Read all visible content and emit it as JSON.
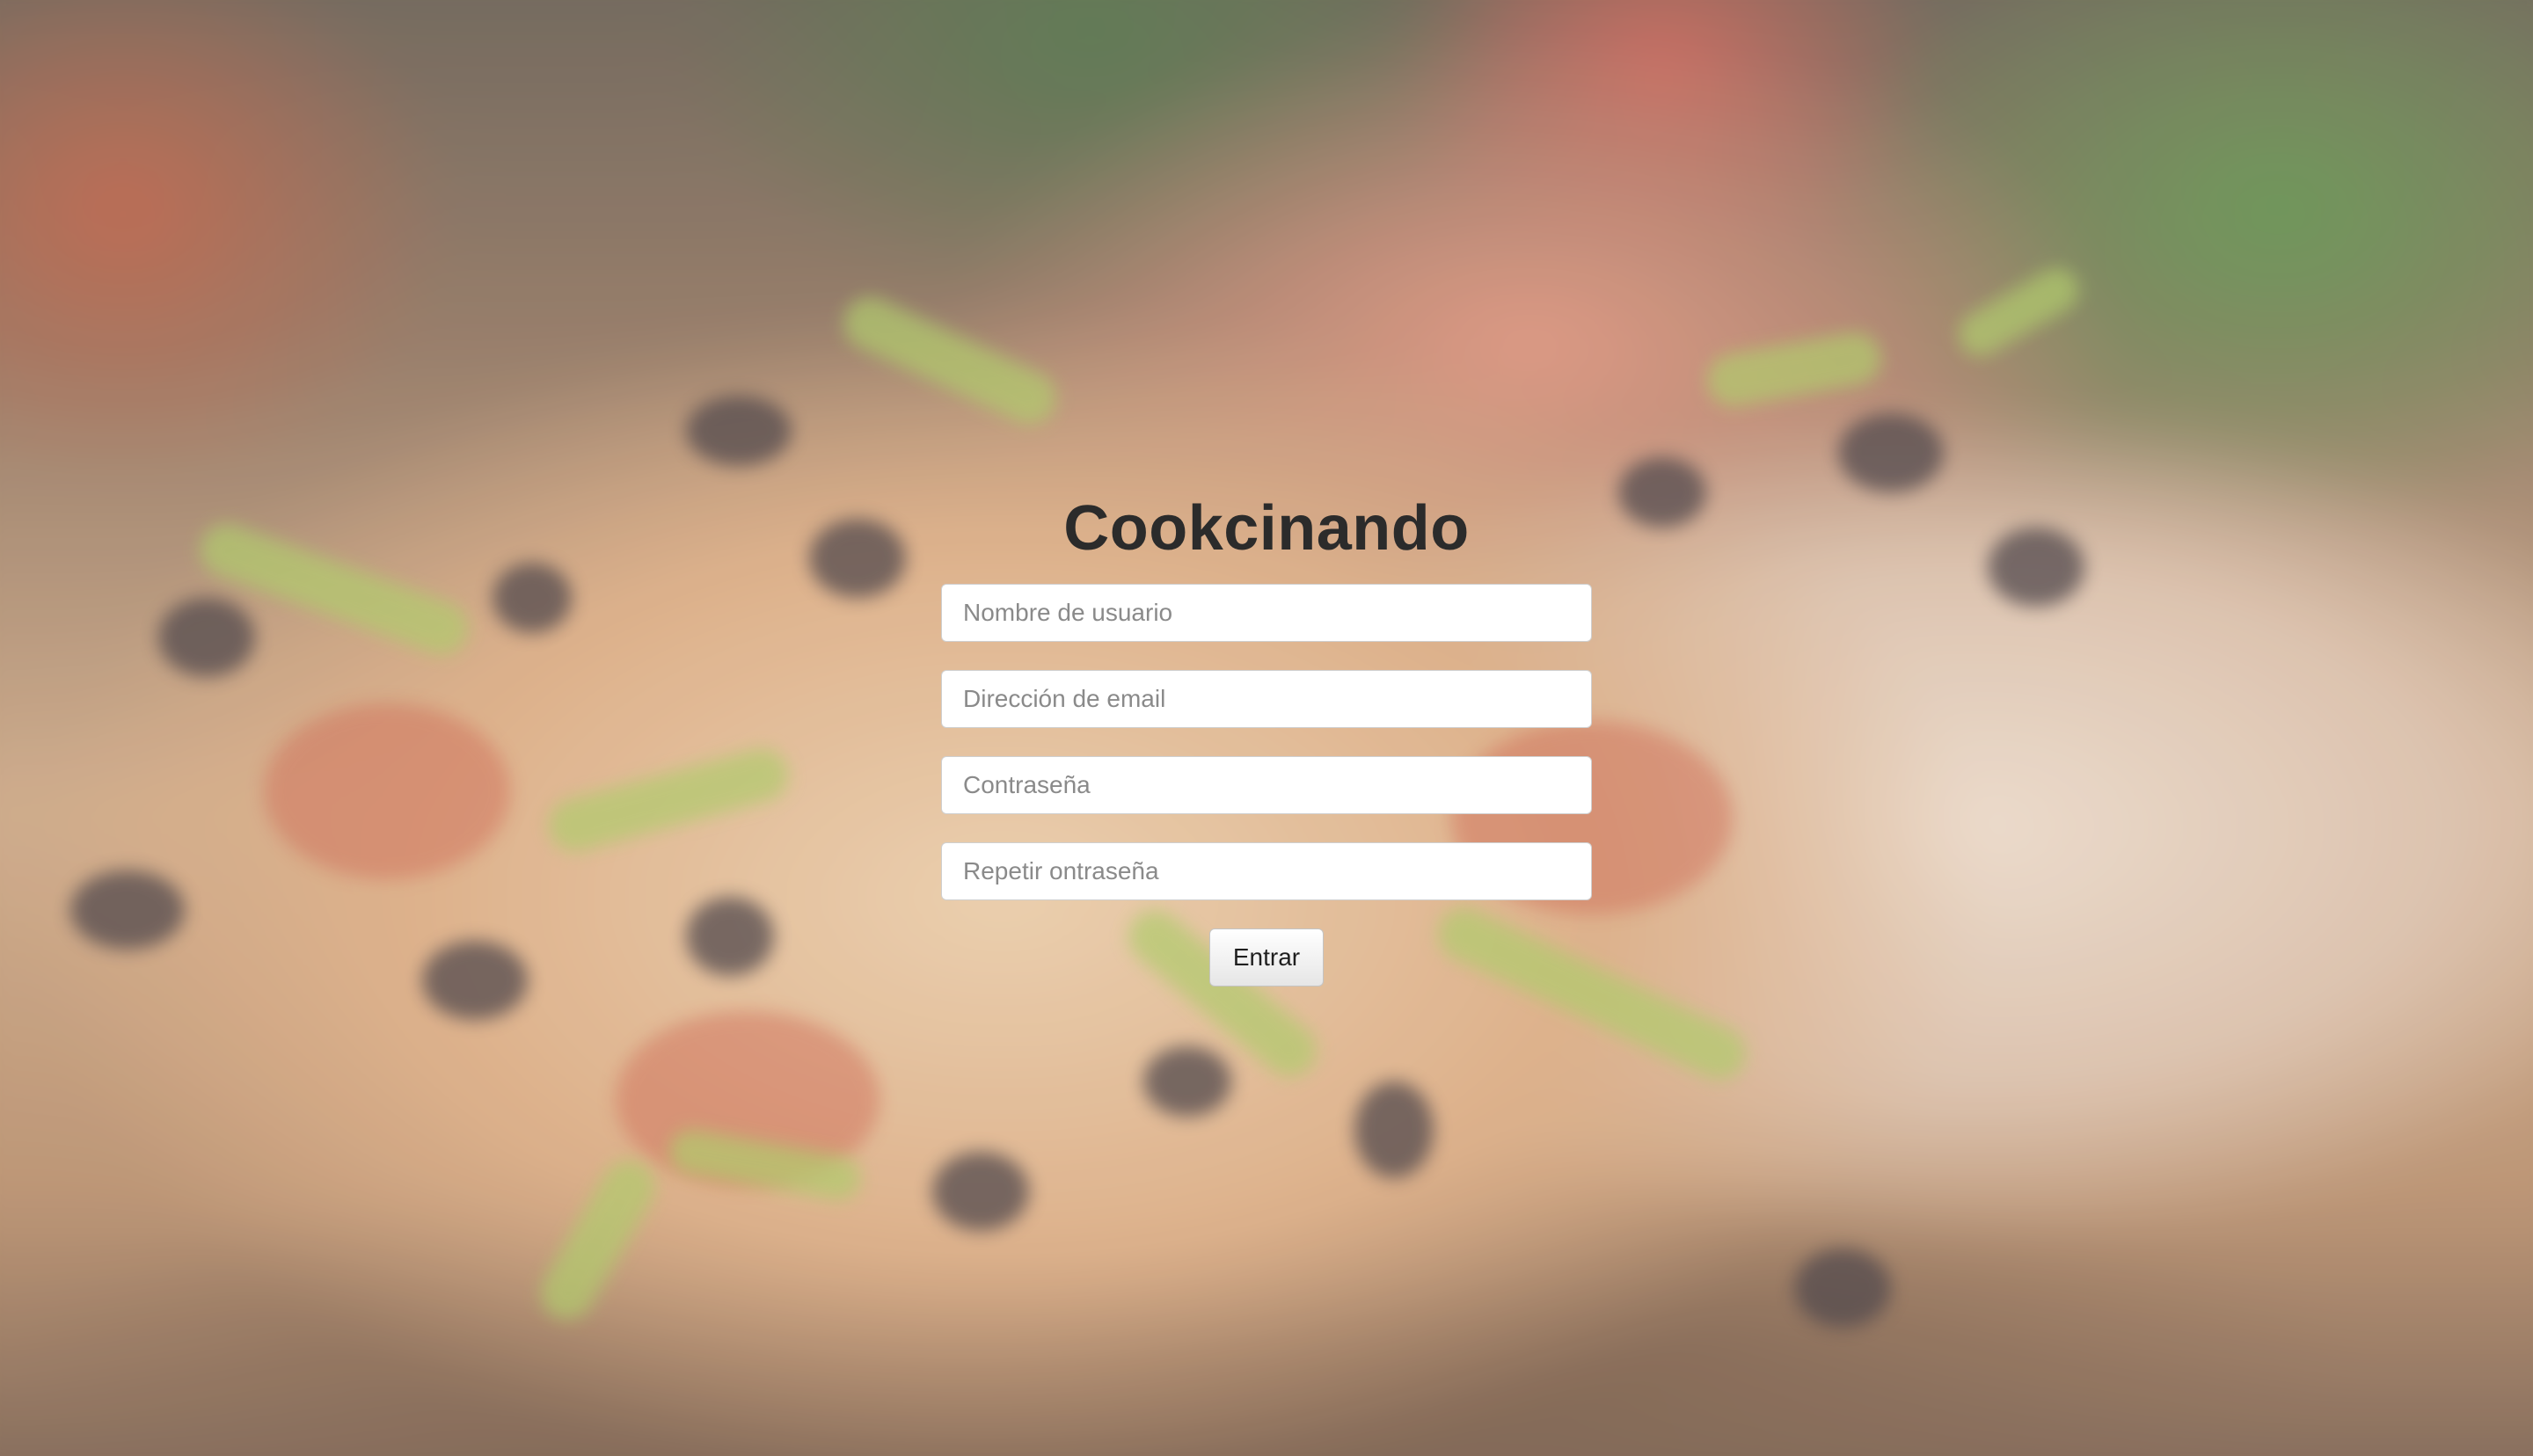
{
  "app": {
    "title": "Cookcinando"
  },
  "form": {
    "username_placeholder": "Nombre de usuario",
    "email_placeholder": "Dirección de email",
    "password_placeholder": "Contraseña",
    "repeat_password_placeholder": "Repetir ontraseña",
    "submit_label": "Entrar"
  },
  "colors": {
    "title": "#2b2b2b",
    "field_background": "#ffffff",
    "placeholder": "#8a8a8a"
  }
}
